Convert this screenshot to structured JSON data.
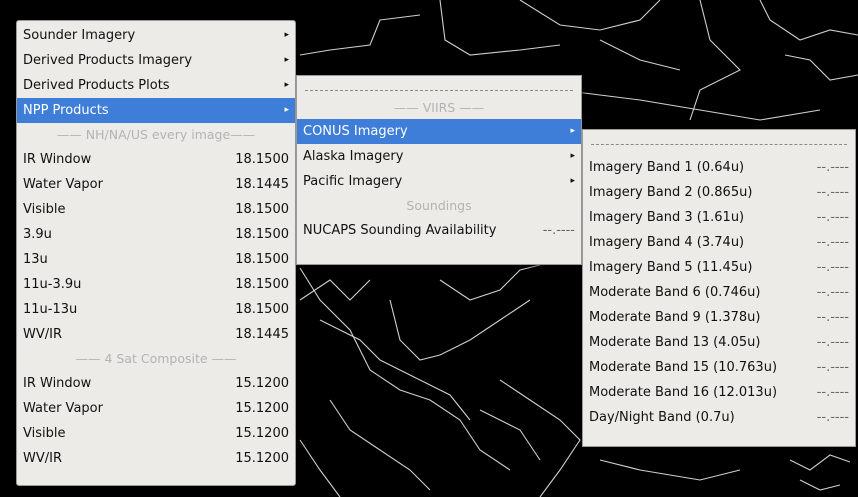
{
  "menu1": {
    "items": [
      {
        "label": "Sounder Imagery",
        "arrow": "▸"
      },
      {
        "label": "Derived Products Imagery",
        "arrow": "▸"
      },
      {
        "label": "Derived Products Plots",
        "arrow": "▸"
      },
      {
        "label": "NPP Products",
        "arrow": "▸"
      }
    ],
    "section1_title": "—— NH/NA/US every image——",
    "section1_rows": [
      {
        "label": "IR Window",
        "value": "18.1500"
      },
      {
        "label": "Water Vapor",
        "value": "18.1445"
      },
      {
        "label": "Visible",
        "value": "18.1500"
      },
      {
        "label": "3.9u",
        "value": "18.1500"
      },
      {
        "label": "13u",
        "value": "18.1500"
      },
      {
        "label": "11u-3.9u",
        "value": "18.1500"
      },
      {
        "label": "11u-13u",
        "value": "18.1500"
      },
      {
        "label": "WV/IR",
        "value": "18.1445"
      }
    ],
    "section2_title": "—— 4 Sat Composite ——",
    "section2_rows": [
      {
        "label": "IR Window",
        "value": "15.1200"
      },
      {
        "label": "Water Vapor",
        "value": "15.1200"
      },
      {
        "label": "Visible",
        "value": "15.1200"
      },
      {
        "label": "WV/IR",
        "value": "15.1200"
      }
    ]
  },
  "menu2": {
    "title_viirs": "—— VIIRS ——",
    "items": [
      {
        "label": "CONUS Imagery",
        "arrow": "▸"
      },
      {
        "label": "Alaska Imagery",
        "arrow": "▸"
      },
      {
        "label": "Pacific Imagery",
        "arrow": "▸"
      }
    ],
    "title_soundings": "Soundings",
    "nucaps": {
      "label": "NUCAPS Sounding Availability",
      "value": "--.----"
    }
  },
  "menu3": {
    "items": [
      {
        "label": "Imagery Band 1 (0.64u)",
        "value": "--.----"
      },
      {
        "label": "Imagery Band 2 (0.865u)",
        "value": "--.----"
      },
      {
        "label": "Imagery Band 3 (1.61u)",
        "value": "--.----"
      },
      {
        "label": "Imagery Band 4 (3.74u)",
        "value": "--.----"
      },
      {
        "label": "Imagery Band 5 (11.45u)",
        "value": "--.----"
      },
      {
        "label": "Moderate Band 6 (0.746u)",
        "value": "--.----"
      },
      {
        "label": "Moderate Band 9 (1.378u)",
        "value": "--.----"
      },
      {
        "label": "Moderate Band 13 (4.05u)",
        "value": "--.----"
      },
      {
        "label": "Moderate Band 15 (10.763u)",
        "value": "--.----"
      },
      {
        "label": "Moderate Band 16 (12.013u)",
        "value": "--.----"
      },
      {
        "label": "Day/Night Band (0.7u)",
        "value": "--.----"
      }
    ]
  },
  "colors": {
    "highlight": "#3e7ed8",
    "menu_bg": "#ecebe8",
    "map_bg": "#000000",
    "map_lines": "#d8d8d8"
  }
}
